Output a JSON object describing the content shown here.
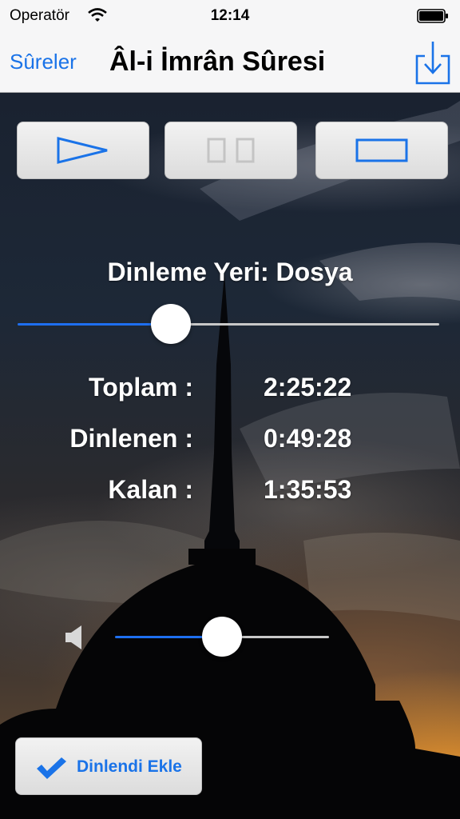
{
  "status_bar": {
    "carrier": "Operatör",
    "time": "12:14",
    "wifi_icon": "wifi-icon",
    "battery_icon": "battery-full-icon"
  },
  "nav": {
    "back_label": "Sûreler",
    "title": "Âl-i İmrân Sûresi",
    "action_icon": "download-icon"
  },
  "controls": {
    "play_icon": "play-icon",
    "pause_icon": "pause-icon",
    "pause_enabled": false,
    "stop_icon": "stop-icon"
  },
  "location_label": "Dinleme Yeri: Dosya",
  "position_slider": {
    "fraction": 0.35
  },
  "times": {
    "total_label": "Toplam :",
    "total_value": "2:25:22",
    "listened_label": "Dinlenen :",
    "listened_value": "0:49:28",
    "remaining_label": "Kalan :",
    "remaining_value": "1:35:53"
  },
  "volume": {
    "icon": "speaker-icon",
    "fraction": 0.5
  },
  "mark_button": {
    "icon": "checkmark-icon",
    "label": "Dinlendi Ekle"
  },
  "colors": {
    "accent": "#1a73e8",
    "bar_background": "#f6f6f7",
    "slider_min_track": "#1e6ff0",
    "slider_max_track": "#c8c8c8"
  }
}
